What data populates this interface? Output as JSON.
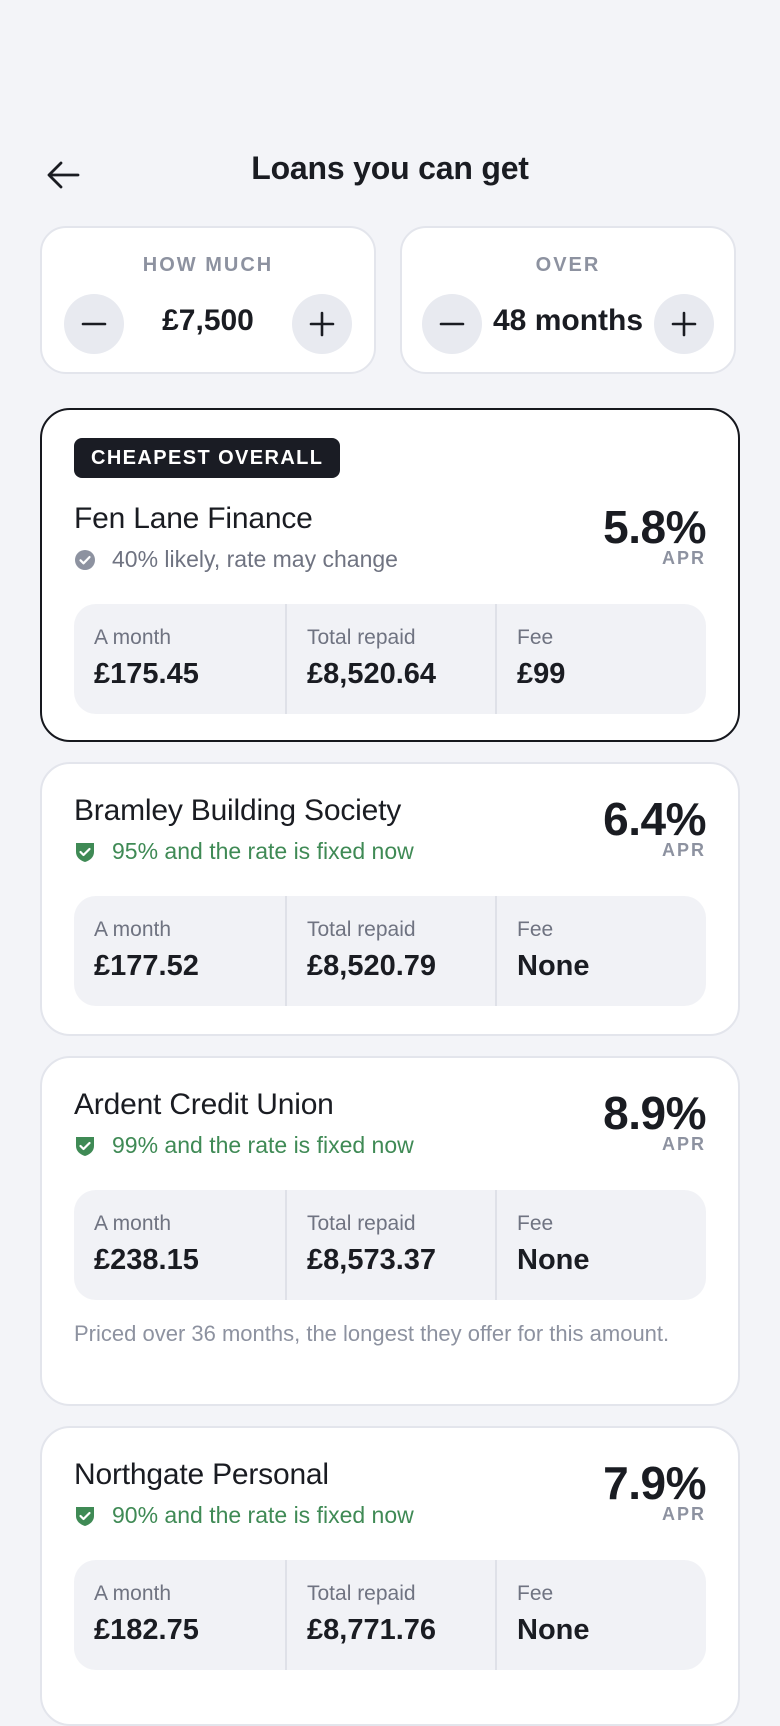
{
  "header": {
    "title": "Loans you can get",
    "back_icon": "arrow-left-icon"
  },
  "amount": {
    "label": "HOW MUCH",
    "value": "£7,500"
  },
  "term": {
    "label": "OVER",
    "value": "48 months"
  },
  "stat_labels": {
    "month": "A month",
    "total": "Total repaid",
    "fee": "Fee"
  },
  "apr_label": "APR",
  "colors": {
    "green": "#3f8a55",
    "grey": "#8d92a0",
    "dark": "#1a1c24"
  },
  "loans": [
    {
      "badge": "CHEAPEST OVERALL",
      "lender": "Fen Lane Finance",
      "likelihood": "40% likely, rate may change",
      "likelihood_icon": "check-circle-icon",
      "apr": "5.8%",
      "monthly": "£175.45",
      "total": "£8,520.64",
      "fee": "£99"
    },
    {
      "lender": "Bramley Building Society",
      "likelihood": "95% and the rate is fixed now",
      "likelihood_icon": "shield-check-icon",
      "apr": "6.4%",
      "monthly": "£177.52",
      "total": "£8,520.79",
      "fee": "None"
    },
    {
      "lender": "Ardent Credit Union",
      "likelihood": "99% and the rate is fixed now",
      "likelihood_icon": "shield-check-icon",
      "apr": "8.9%",
      "monthly": "£238.15",
      "total": "£8,573.37",
      "fee": "None",
      "note": "Priced over 36 months, the longest they offer for this amount."
    },
    {
      "lender": "Northgate Personal",
      "likelihood": "90% and the rate is fixed now",
      "likelihood_icon": "shield-check-icon",
      "apr": "7.9%",
      "monthly": "£182.75",
      "total": "£8,771.76",
      "fee": "None"
    }
  ]
}
